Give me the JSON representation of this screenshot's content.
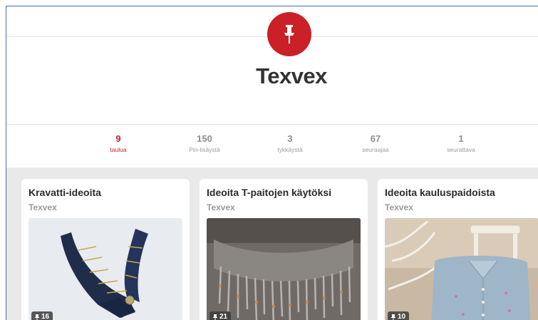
{
  "profile": {
    "name": "Texvex",
    "brand_color": "#cb2027"
  },
  "stats": [
    {
      "count": "9",
      "label": "taulua",
      "active": true
    },
    {
      "count": "150",
      "label": "Pin-lisäystä",
      "active": false
    },
    {
      "count": "3",
      "label": "tykkäystä",
      "active": false
    },
    {
      "count": "67",
      "label": "seuraajaa",
      "active": false
    },
    {
      "count": "1",
      "label": "seurattava",
      "active": false
    }
  ],
  "boards": [
    {
      "title": "Kravatti-ideoita",
      "owner": "Texvex",
      "pin_count": "16",
      "cover_icon": "pin-icon"
    },
    {
      "title": "Ideoita T-paitojen käytöksi",
      "owner": "Texvex",
      "pin_count": "21",
      "cover_icon": "pin-icon"
    },
    {
      "title": "Ideoita kauluspaidoista",
      "owner": "Texvex",
      "pin_count": "10",
      "cover_icon": "pin-icon"
    }
  ]
}
